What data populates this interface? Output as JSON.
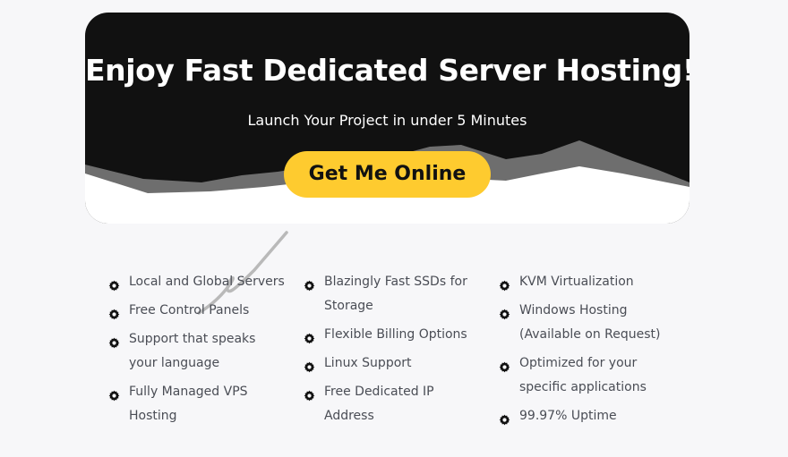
{
  "hero": {
    "title": "Enjoy Fast Dedicated Server Hosting!",
    "subtitle": "Launch Your Project in under 5 Minutes",
    "cta_label": "Get Me Online"
  },
  "features": {
    "icon": "gear-icon",
    "columns": [
      [
        "Local and Global Servers",
        "Free Control Panels",
        "Support that speaks your language",
        "Fully Managed VPS Hosting"
      ],
      [
        "Blazingly Fast SSDs for Storage",
        "Flexible Billing Options",
        "Linux Support",
        "Free Dedicated IP Address"
      ],
      [
        "KVM Virtualization",
        "Windows Hosting (Available on Request)",
        "Optimized for your specific applications",
        "99.97% Uptime"
      ]
    ]
  },
  "colors": {
    "hero_bg": "#111111",
    "cta_bg": "#fecb2f",
    "mountain": "#6e6e6e",
    "text": "#4a4d55"
  }
}
